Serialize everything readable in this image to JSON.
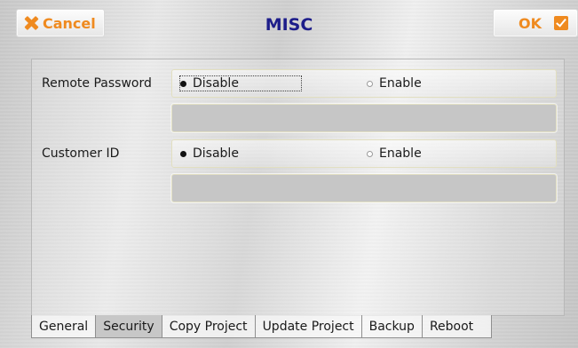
{
  "header": {
    "title": "MISC",
    "cancel_label": "Cancel",
    "ok_label": "OK"
  },
  "rows": [
    {
      "label": "Remote Password",
      "option_disable": "Disable",
      "option_enable": "Enable",
      "selected": "Disable",
      "field_value": ""
    },
    {
      "label": "Customer ID",
      "option_disable": "Disable",
      "option_enable": "Enable",
      "selected": "Disable",
      "field_value": ""
    }
  ],
  "tabs": [
    "General",
    "Security",
    "Copy Project",
    "Update Project",
    "Backup",
    "Reboot"
  ],
  "active_tab": "Security",
  "colors": {
    "accent": "#ef8a1f",
    "title": "#1d1d8a"
  },
  "icons": {
    "cancel": "x-icon",
    "ok": "check-icon"
  }
}
